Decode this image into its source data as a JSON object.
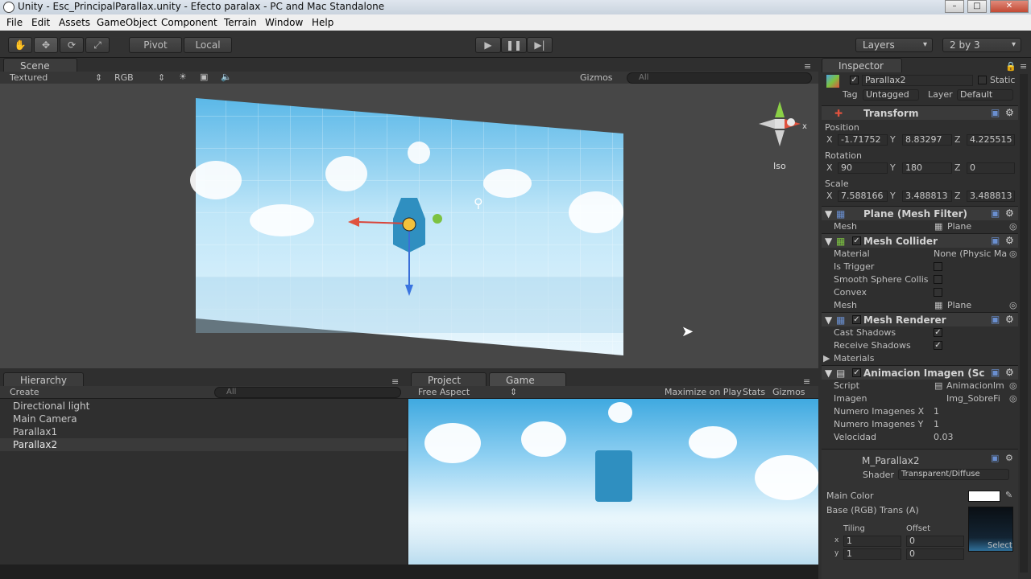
{
  "window": {
    "title": "Unity - Esc_PrincipalParallax.unity - Efecto paralax - PC and Mac Standalone",
    "minimize": "–",
    "maximize": "□",
    "close": "✕"
  },
  "menu": [
    "File",
    "Edit",
    "Assets",
    "GameObject",
    "Component",
    "Terrain",
    "Window",
    "Help"
  ],
  "toolbar": {
    "tools": [
      "hand-icon",
      "move-icon",
      "rotate-icon",
      "scale-icon"
    ],
    "pivot": "Pivot",
    "local": "Local",
    "play_icon": "play-icon",
    "pause_icon": "pause-icon",
    "step_icon": "step-icon",
    "layers": "Layers",
    "layout": "2 by 3"
  },
  "scene": {
    "tab": "Scene",
    "render_mode": "Textured",
    "channel": "RGB",
    "gizmos": "Gizmos",
    "search_placeholder": "All",
    "iso": "Iso",
    "gizmo_x": "x"
  },
  "hierarchy": {
    "tab": "Hierarchy",
    "create": "Create",
    "search_placeholder": "All",
    "items": [
      "Directional light",
      "Main Camera",
      "Parallax1",
      "Parallax2"
    ],
    "selected": "Parallax2"
  },
  "project": {
    "tab": "Project"
  },
  "game": {
    "tab": "Game",
    "aspect": "Free Aspect",
    "maximize_on_play": "Maximize on Play",
    "stats": "Stats",
    "gizmos": "Gizmos"
  },
  "inspector": {
    "tab": "Inspector",
    "object_name": "Parallax2",
    "static": "Static",
    "tag_label": "Tag",
    "tag": "Untagged",
    "layer_label": "Layer",
    "layer": "Default",
    "transform": {
      "title": "Transform",
      "position_label": "Position",
      "position": {
        "x": "-1.71752",
        "y": "8.83297",
        "z": "4.225515"
      },
      "rotation_label": "Rotation",
      "rotation": {
        "x": "90",
        "y": "180",
        "z": "0"
      },
      "scale_label": "Scale",
      "scale": {
        "x": "7.588166",
        "y": "3.488813",
        "z": "3.488813"
      },
      "x": "X",
      "y": "Y",
      "z": "Z"
    },
    "mesh_filter": {
      "title": "Plane (Mesh Filter)",
      "mesh_label": "Mesh",
      "mesh": "Plane"
    },
    "mesh_collider": {
      "title": "Mesh Collider",
      "material_label": "Material",
      "material": "None (Physic Ma",
      "is_trigger": "Is Trigger",
      "smooth": "Smooth Sphere Collis",
      "convex": "Convex",
      "mesh_label": "Mesh",
      "mesh": "Plane"
    },
    "mesh_renderer": {
      "title": "Mesh Renderer",
      "cast": "Cast Shadows",
      "receive": "Receive Shadows",
      "materials": "Materials"
    },
    "anim": {
      "title": "Animacion Imagen (Scri",
      "script_label": "Script",
      "script": "AnimacionIm",
      "imagen_label": "Imagen",
      "imagen": "Img_SobreFi",
      "nx_label": "Numero Imagenes X",
      "nx": "1",
      "ny_label": "Numero Imagenes Y",
      "ny": "1",
      "vel_label": "Velocidad",
      "vel": "0.03"
    },
    "material": {
      "name": "M_Parallax2",
      "shader_label": "Shader",
      "shader": "Transparent/Diffuse",
      "main_color": "Main Color",
      "base": "Base (RGB) Trans (A)",
      "tiling": "Tiling",
      "offset": "Offset",
      "tx": "1",
      "ty": "1",
      "ox": "0",
      "oy": "0",
      "x": "x",
      "y": "y",
      "select": "Select"
    }
  },
  "colors": {
    "accent": "#3d6aa8",
    "selected_row": "#3a3a3a",
    "sky_top": "#3fa9e0"
  }
}
